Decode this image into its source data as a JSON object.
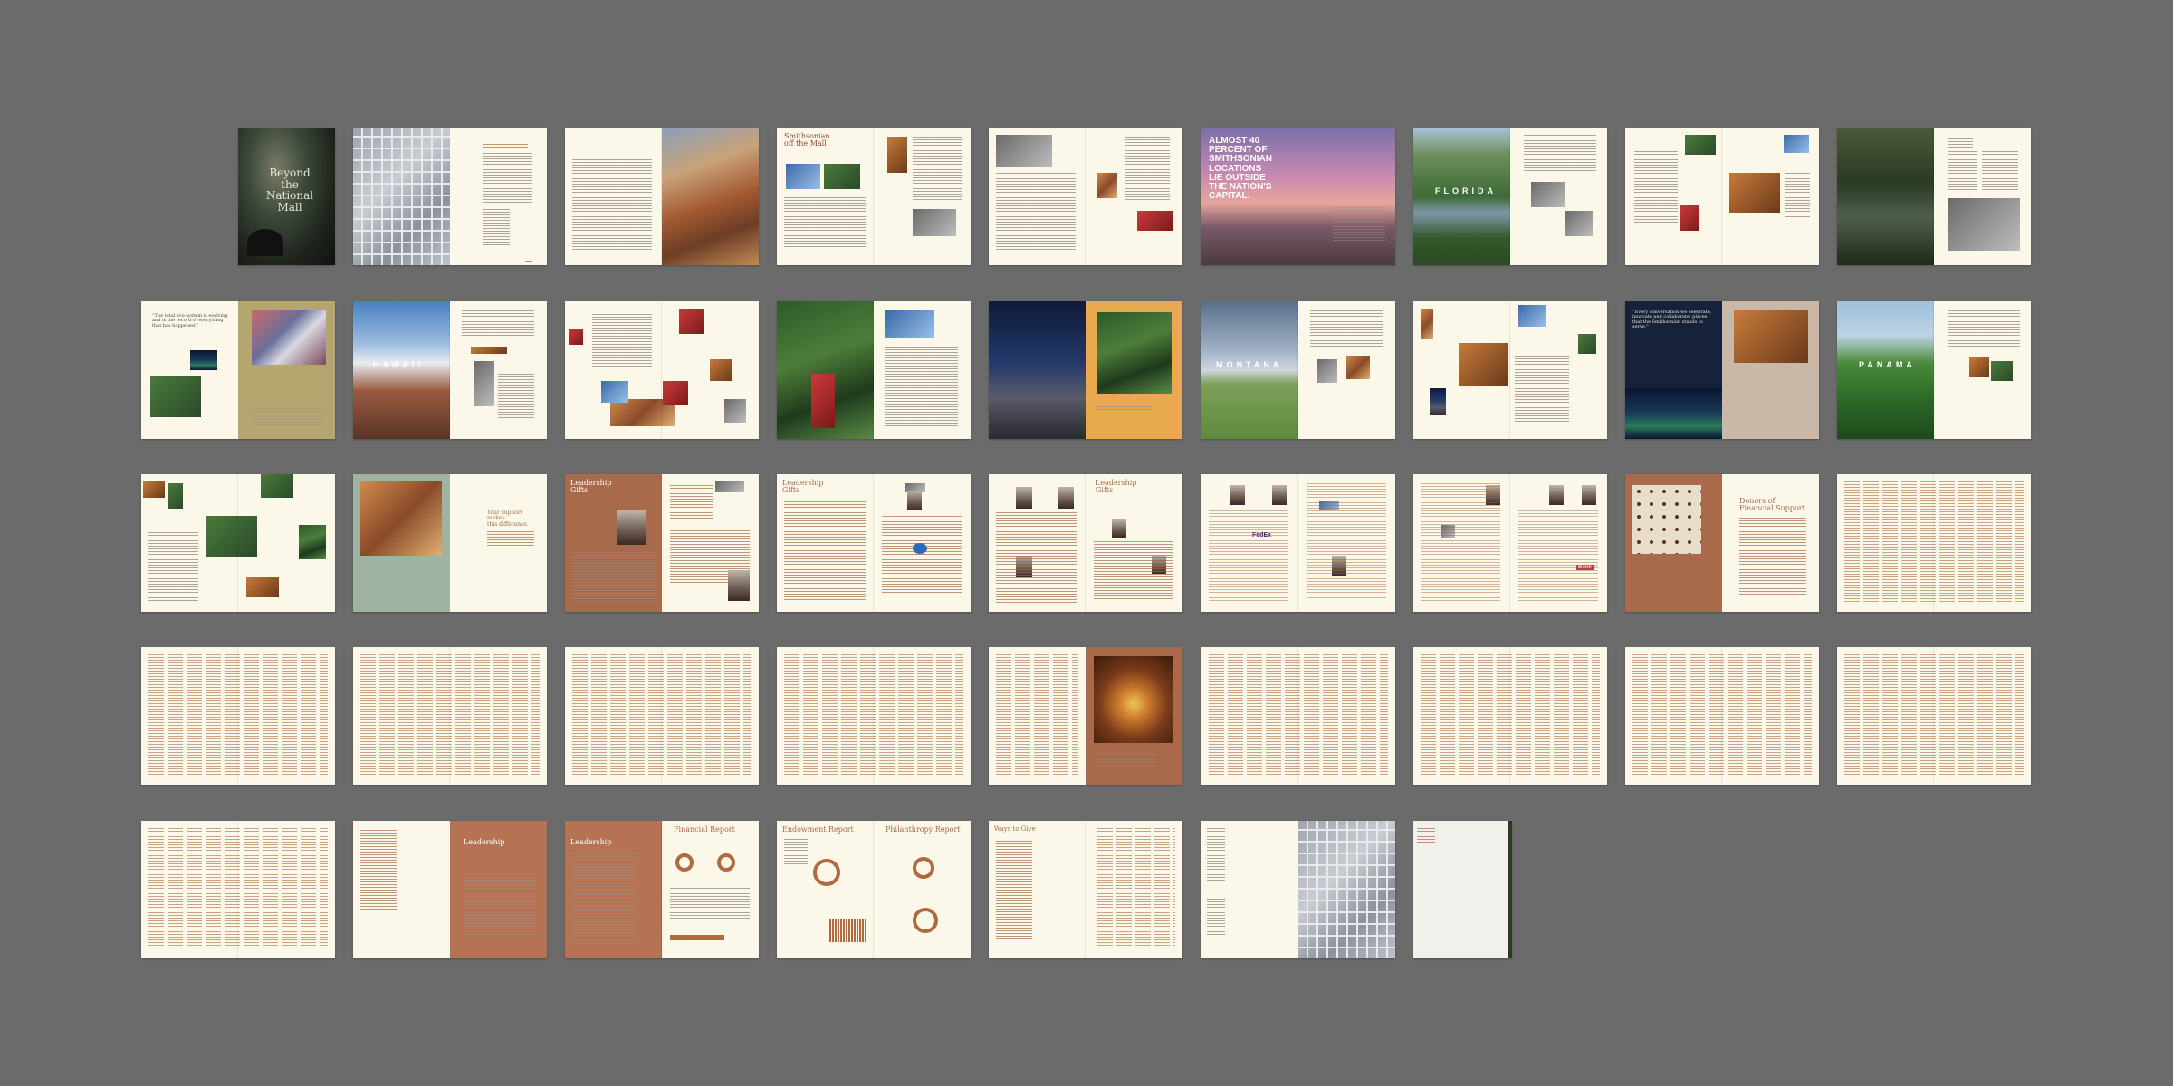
{
  "viewer": {
    "background_color": "#6b6b6b",
    "page_background_color": "#fbf8ea",
    "accent_color": "#a86a4a"
  },
  "cover": {
    "title_line1": "Beyond",
    "title_line2": "the",
    "title_line3": "National",
    "title_line4": "Mall"
  },
  "callouts": {
    "almost_40": [
      "ALMOST 40",
      "PERCENT OF",
      "SMITHSONIAN",
      "LOCATIONS",
      "LIE OUTSIDE",
      "THE NATION'S",
      "CAPITAL."
    ],
    "florida": "FLORIDA",
    "hawaii": "HAWAII",
    "montana": "MONTANA",
    "panama": "PANAMA"
  },
  "section_titles": {
    "smithsonian_off_mall_1": "Smithsonian",
    "smithsonian_off_mall_2": "off the Mall",
    "leadership_gifts": "Leadership Gifts",
    "leadership_gifts_2": "Leadership",
    "leadership_gifts_3": "Gifts",
    "donors_1": "Donors of",
    "donors_2": "Financial Support",
    "leadership": "Leadership",
    "financial_report": "Financial Report",
    "endowment_report": "Endowment Report",
    "philanthropy_report": "Philanthropy Report",
    "ways_to_give": "Ways to Give",
    "your_support_1": "Your support makes",
    "your_support_2": "this difference."
  },
  "quotes": {
    "q1": "“The total eco-system is evolving and is the record of everything that has happened.”",
    "q2": "“Every conversation we celebrate, innovate and collaborate, places that the Smithsonian stands to serve.”"
  },
  "logos": {
    "fedex": "FedEx",
    "bank": "Bank"
  }
}
